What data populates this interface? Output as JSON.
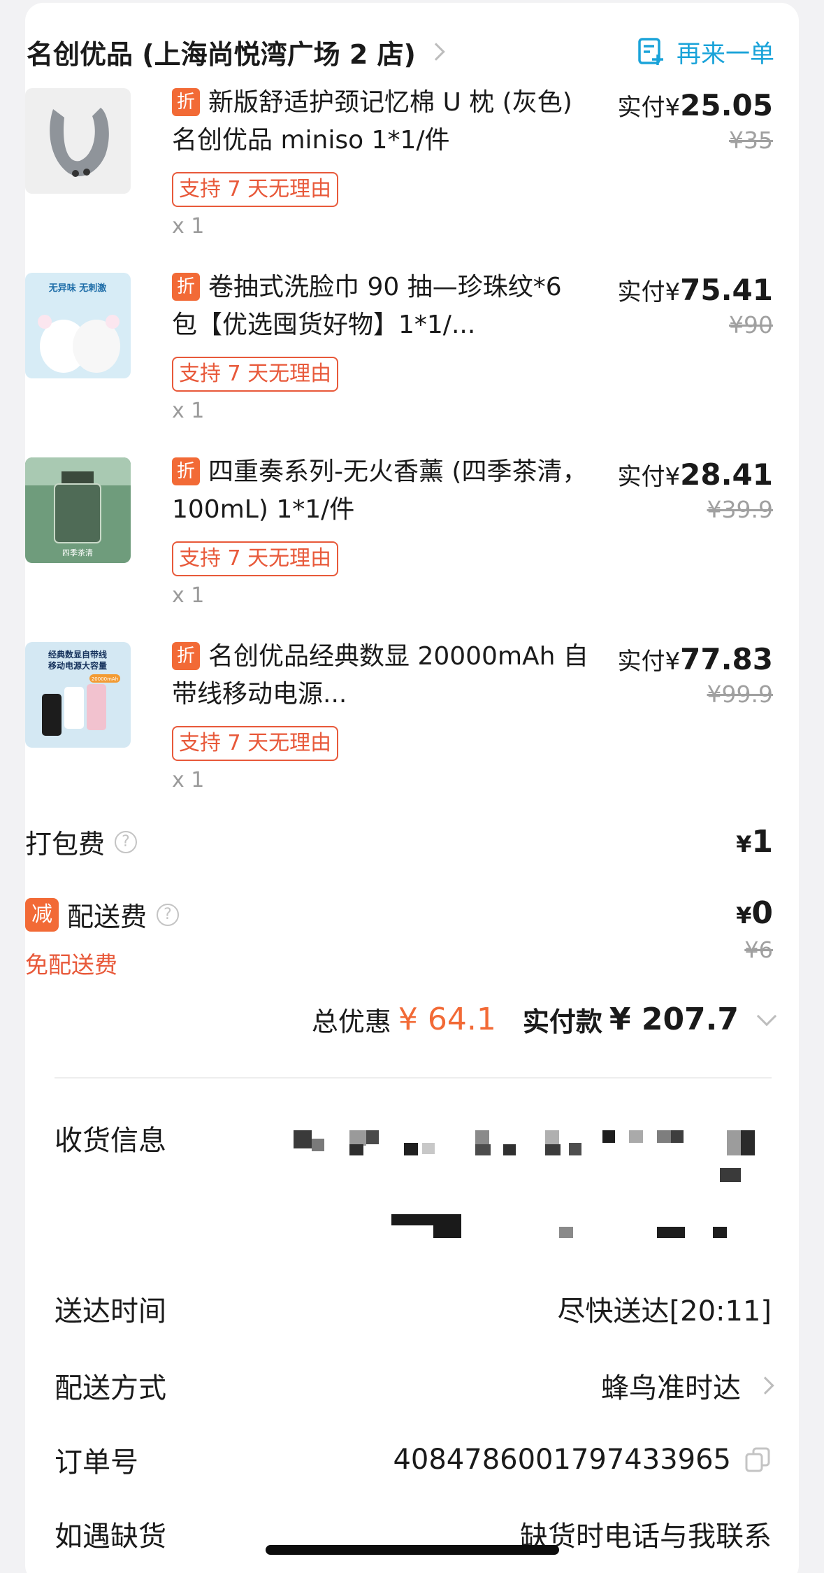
{
  "store": {
    "name": "名创优品 (上海尚悦湾广场 2 店)",
    "reorder_label": "再来一单"
  },
  "items": [
    {
      "discount_tag": "折",
      "title": "新版舒适护颈记忆棉 U 枕 (灰色) 名创优品 miniso 1*1/件",
      "support_tag": "支持 7 天无理由",
      "qty": "x 1",
      "paid_prefix": "实付¥",
      "paid": "25.05",
      "original": "¥35"
    },
    {
      "discount_tag": "折",
      "title": "卷抽式洗脸巾 90 抽—珍珠纹*6 包【优选囤货好物】1*1/...",
      "support_tag": "支持 7 天无理由",
      "qty": "x 1",
      "paid_prefix": "实付¥",
      "paid": "75.41",
      "original": "¥90",
      "thumb_text_1": "无异味  无刺激"
    },
    {
      "discount_tag": "折",
      "title": "四重奏系列-无火香薰 (四季茶清，100mL) 1*1/件",
      "support_tag": "支持 7 天无理由",
      "qty": "x 1",
      "paid_prefix": "实付¥",
      "paid": "28.41",
      "original": "¥39.9",
      "thumb_text_1": "四季茶清"
    },
    {
      "discount_tag": "折",
      "title": "名创优品经典数显 20000mAh 自带线移动电源...",
      "support_tag": "支持 7 天无理由",
      "qty": "x 1",
      "paid_prefix": "实付¥",
      "paid": "77.83",
      "original": "¥99.9",
      "thumb_text_1": "经典数显自带线",
      "thumb_text_2": "移动电源大容量",
      "thumb_text_3": "20000mAh"
    }
  ],
  "fees": {
    "packing_label": "打包费",
    "packing_value": "1",
    "delivery_badge": "减",
    "delivery_label": "配送费",
    "delivery_value": "0",
    "delivery_original": "¥6",
    "delivery_free_text": "免配送费",
    "currency": "¥"
  },
  "totals": {
    "discount_label": "总优惠",
    "discount_value": "¥ 64.1",
    "paid_label": "实付款",
    "paid_value": "¥ 207.7"
  },
  "info": {
    "receiver_label": "收货信息",
    "delivery_time_label": "送达时间",
    "delivery_time_value": "尽快送达[20:11]",
    "delivery_method_label": "配送方式",
    "delivery_method_value": "蜂鸟准时达",
    "order_no_label": "订单号",
    "order_no_value": "4084786001797433965",
    "out_of_stock_label": "如遇缺货",
    "out_of_stock_value": "缺货时电话与我联系"
  },
  "colors": {
    "accent_orange": "#f26a36",
    "tag_red": "#e8593a",
    "link_blue": "#1aa3d9"
  },
  "icons": [
    "chevron-right-icon",
    "reorder-icon",
    "help-icon",
    "chevron-down-icon",
    "copy-icon"
  ]
}
